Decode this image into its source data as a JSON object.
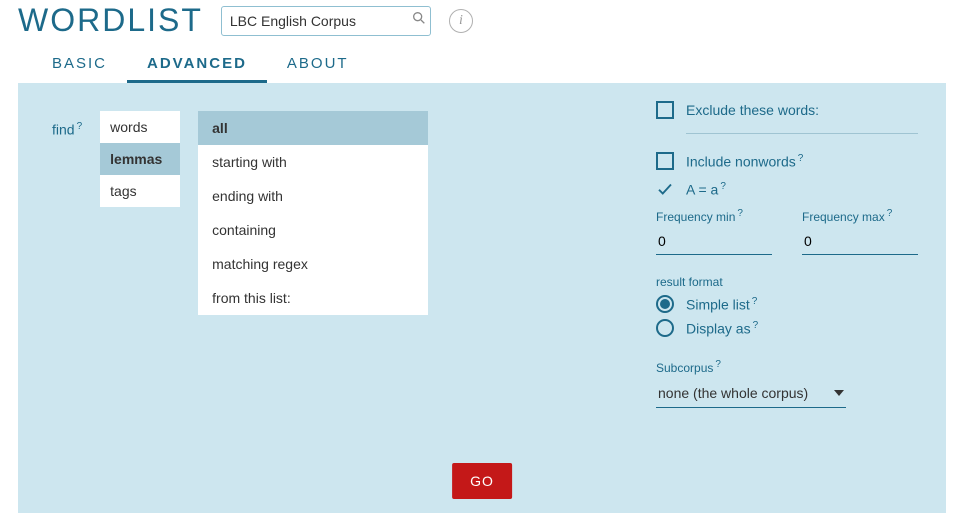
{
  "header": {
    "title": "WORDLIST",
    "corpus_value": "LBC English Corpus"
  },
  "tabs": {
    "basic": "BASIC",
    "advanced": "ADVANCED",
    "about": "ABOUT"
  },
  "left": {
    "find_label": "find",
    "help_q": "?",
    "units": {
      "words": "words",
      "lemmas": "lemmas",
      "tags": "tags"
    },
    "filters": {
      "all": "all",
      "starting": "starting with",
      "ending": "ending with",
      "containing": "containing",
      "regex": "matching regex",
      "fromlist": "from this list:"
    }
  },
  "right": {
    "exclude_label": "Exclude these words:",
    "nonwords_label": "Include nonwords",
    "case_label": "A = a",
    "freq_min_label": "Frequency min",
    "freq_max_label": "Frequency max",
    "freq_min_value": "0",
    "freq_max_value": "0",
    "result_format_label": "result format",
    "simple_list_label": "Simple list",
    "display_as_label": "Display as",
    "subcorpus_label": "Subcorpus",
    "subcorpus_value": "none (the whole corpus)"
  },
  "go_button": "GO"
}
